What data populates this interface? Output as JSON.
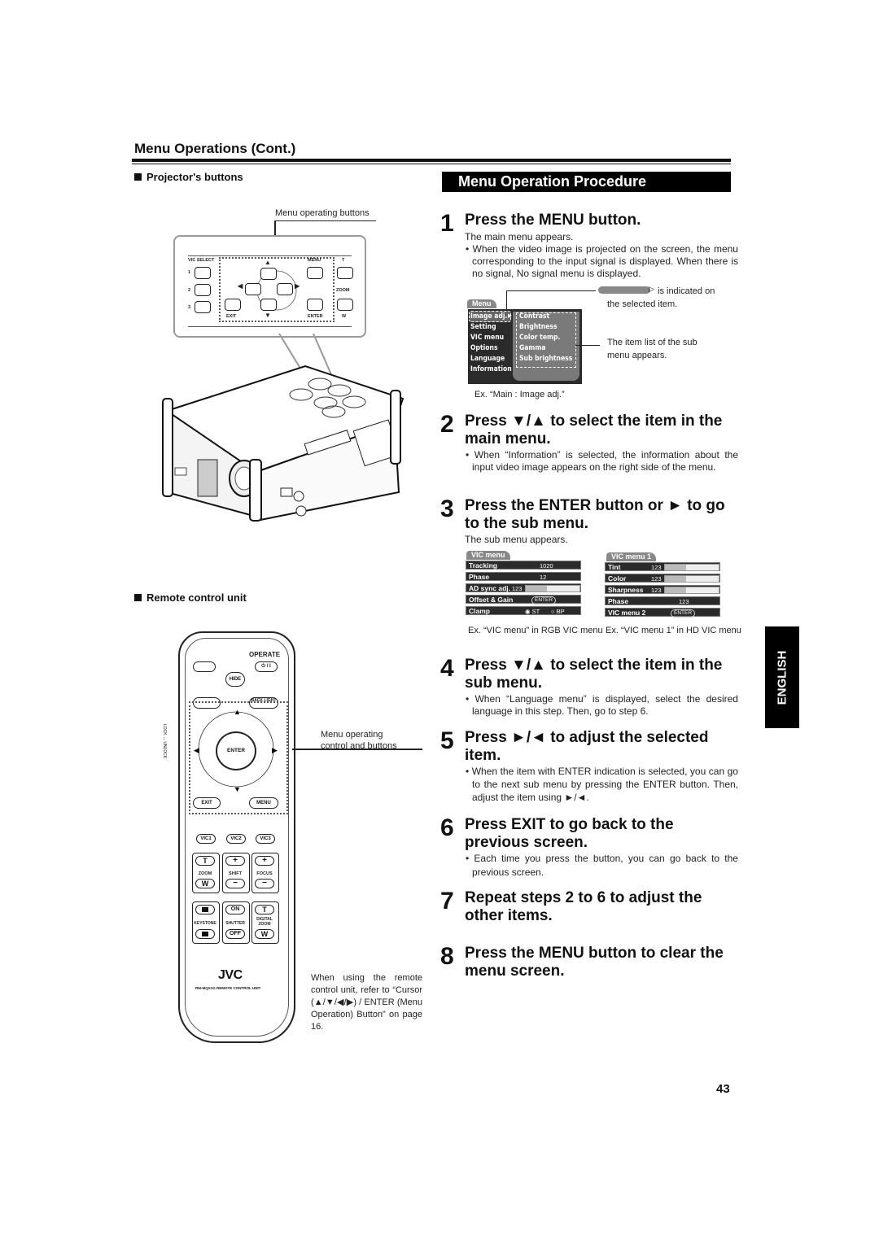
{
  "section_title": "Menu Operations (Cont.)",
  "projector": {
    "heading": "Projector's buttons",
    "callout": "Menu operating buttons",
    "panel_labels": {
      "vic_select": "VIC SELECT",
      "n1": "1",
      "n2": "2",
      "n3": "3",
      "menu": "MENU",
      "exit": "EXIT",
      "enter": "ENTER",
      "t": "T",
      "zoom": "ZOOM",
      "w": "W"
    },
    "arrows": {
      "up": "▲",
      "down": "▼",
      "left": "◀",
      "right": "▶"
    }
  },
  "remote": {
    "heading": "Remote control unit",
    "callout": "Menu operating control and buttons",
    "buttons": {
      "operate": "OPERATE",
      "power": "⏻ / I",
      "hide": "HIDE",
      "back_light": "BACK LIGHT",
      "enter": "ENTER",
      "exit": "EXIT",
      "menu": "MENU",
      "vic1": "VIC1",
      "vic2": "VIC2",
      "vic3": "VIC3",
      "zoom_t": "T",
      "zoom": "ZOOM",
      "zoom_w": "W",
      "shift_plus": "+",
      "shift": "SHIFT",
      "shift_minus": "−",
      "focus_plus": "+",
      "focus": "FOCUS",
      "focus_minus": "−",
      "keystone": "KEYSTONE",
      "shutter_on": "ON",
      "shutter": "SHUTTER",
      "shutter_off": "OFF",
      "dzoom_t": "T",
      "digital_zoom": "DIGITAL ZOOM",
      "dzoom_w": "W"
    },
    "lock_label": "LOCK ↔ UNLOCK",
    "brand": "JVC",
    "model": "RM-MQX1G REMOTE CONTROL UNIT",
    "note": "When using the remote control unit, refer to “Cursor (▲/▼/◀/▶) / ENTER (Menu Operation) Button” on page 16."
  },
  "procedure": {
    "banner": "Menu Operation Procedure",
    "steps": [
      {
        "num": "1",
        "title": "Press the MENU button.",
        "lead": "The main menu appears.",
        "bullets": [
          "When the video image is projected on the screen, the menu corresponding to the input signal is displayed. When there is no signal, No signal menu is displayed."
        ]
      },
      {
        "num": "2",
        "title": "Press ▼/▲ to select the item in the main menu.",
        "bullets": [
          "When “Information” is selected, the information about the input video image appears on the right side of the menu."
        ]
      },
      {
        "num": "3",
        "title": "Press the ENTER button or ► to go to the sub menu.",
        "lead": "The sub menu appears."
      },
      {
        "num": "4",
        "title": "Press ▼/▲ to select the item in the sub menu.",
        "bullets": [
          "When “Language menu” is displayed, select the desired language in this step. Then, go to step 6."
        ]
      },
      {
        "num": "5",
        "title": "Press ►/◄ to adjust the selected item.",
        "bullets": [
          "When the item with ENTER indication is selected, you can go to the next sub menu by pressing the ENTER button. Then, adjust the item using ►/◄."
        ]
      },
      {
        "num": "6",
        "title": "Press EXIT to go back to the previous screen.",
        "bullets": [
          "Each time you press the button, you can go back to the previous screen."
        ]
      },
      {
        "num": "7",
        "title": "Repeat steps 2 to 6 to adjust the other items."
      },
      {
        "num": "8",
        "title": "Press the MENU button to clear the menu screen."
      }
    ]
  },
  "main_menu_example": {
    "tab": "Menu",
    "items": [
      "Image adj.",
      "Setting",
      "VIC menu",
      "Options",
      "Language",
      "Information"
    ],
    "selected": "Image adj.",
    "sub_items": [
      "Contrast",
      "Brightness",
      "Color temp.",
      "Gamma",
      "Sub brightness"
    ],
    "note_selected": "is indicated on the selected item.",
    "note_sublist": "The item list of the sub menu appears.",
    "caption": "Ex. “Main : Image adj.”"
  },
  "vic_rgb_example": {
    "tab": "VIC menu",
    "rows": [
      {
        "label": "Tracking",
        "value": "1020"
      },
      {
        "label": "Phase",
        "value": "12"
      },
      {
        "label": "AD sync adj.",
        "value": "123",
        "bar_fraction": 0.4
      },
      {
        "label": "Offset & Gain",
        "badge": "ENTER"
      },
      {
        "label": "Clamp",
        "opt1": "ST",
        "opt2": "BP",
        "selected": "ST"
      }
    ],
    "caption": "Ex. “VIC menu” in RGB VIC menu"
  },
  "vic_hd_example": {
    "tab": "VIC menu 1",
    "rows": [
      {
        "label": "Tint",
        "value": "123",
        "bar_fraction": 0.4
      },
      {
        "label": "Color",
        "value": "123",
        "bar_fraction": 0.4
      },
      {
        "label": "Sharpness",
        "value": "123",
        "bar_fraction": 0.4
      },
      {
        "label": "Phase",
        "value": "123"
      },
      {
        "label": "VIC menu 2",
        "badge": "ENTER"
      }
    ],
    "caption": "Ex. “VIC menu 1” in HD VIC menu"
  },
  "side_tab": "ENGLISH",
  "page_number": "43"
}
